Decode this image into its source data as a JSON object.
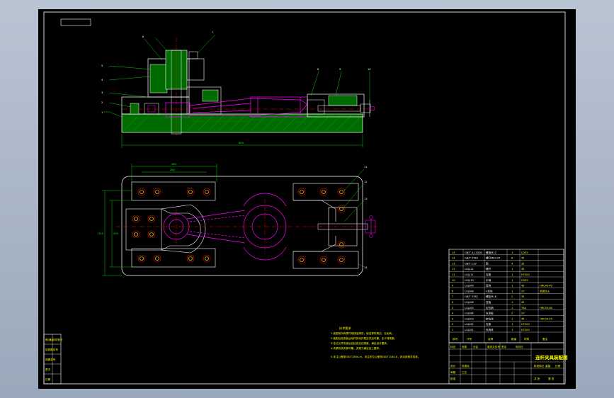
{
  "drawing": {
    "title_block_name": "连杆夹具装配图",
    "notes_heading": "技术要求",
    "notes": [
      "1.装配前所有零件用煤油清洗，保证零件清洁、无毛刺。",
      "2.装配后检查各运动件的动作是否灵活可靠，无卡滞现象。",
      "3.定位元件安装后应检查定位精度，满足设计要求。",
      "4.夹紧机构夹紧可靠，夹紧力满足加工要求。"
    ],
    "note_extra": "5.未注公差按GB/T1804-m，未注形位公差按GB/T1184-K，其余按相关标准。",
    "front_view_labels": [
      "1",
      "2",
      "3",
      "4",
      "5",
      "6",
      "7",
      "8",
      "9",
      "10"
    ],
    "plan_view_labels": [
      "11",
      "12",
      "13",
      "14"
    ],
    "dimensions": {
      "overall_length": "800",
      "top_width": "360",
      "inner_width": "280",
      "side_height": "320",
      "inner_height": "290"
    },
    "bom_headers": [
      "序号",
      "代号",
      "名称",
      "数量",
      "材料",
      "备注"
    ],
    "bom_rows": [
      [
        "15",
        "GB/T 41-2000",
        "螺母M12",
        "1",
        "Q235",
        ""
      ],
      [
        "14",
        "GB/T 5783",
        "螺钉M8×25",
        "8",
        "35",
        ""
      ],
      [
        "13",
        "GB/T 119",
        "销",
        "4",
        "35",
        ""
      ],
      [
        "12",
        "LGJJ-12",
        "螺杆",
        "1",
        "45",
        ""
      ],
      [
        "11",
        "LGJJ-11",
        "支座",
        "1",
        "HT200",
        ""
      ],
      [
        "10",
        "LGJJ-10",
        "手柄",
        "1",
        "Q235",
        ""
      ],
      [
        "9",
        "LGJJ-09",
        "压块",
        "1",
        "45",
        "HRC40-45"
      ],
      [
        "8",
        "LGJJ-08",
        "V形块",
        "1",
        "20",
        "渗碳淬火"
      ],
      [
        "7",
        "GB/T 5782",
        "螺栓M16",
        "2",
        "35",
        ""
      ],
      [
        "6",
        "LGJJ-06",
        "压板",
        "1",
        "45",
        ""
      ],
      [
        "5",
        "LGJJ-05",
        "定位销",
        "1",
        "T8A",
        "HRC55-60"
      ],
      [
        "4",
        "LGJJ-04",
        "支承板",
        "2",
        "20",
        ""
      ],
      [
        "3",
        "LGJJ-03",
        "定位块",
        "1",
        "45",
        "HRC40-45"
      ],
      [
        "2",
        "LGJJ-02",
        "支架",
        "1",
        "HT200",
        ""
      ],
      [
        "1",
        "LGJJ-01",
        "夹具体",
        "1",
        "HT200",
        ""
      ]
    ],
    "title_block_fields": [
      "标记",
      "处数",
      "分区",
      "更改文件号",
      "签名",
      "年月日",
      "设计",
      "标准化",
      "审核",
      "工艺",
      "批准",
      "阶段标记",
      "重量",
      "比例",
      "共 张",
      "第 张"
    ],
    "left_strip_fields": [
      "借(通)用件登记",
      "旧底图总号",
      "底图总号",
      "签字",
      "日期"
    ]
  }
}
